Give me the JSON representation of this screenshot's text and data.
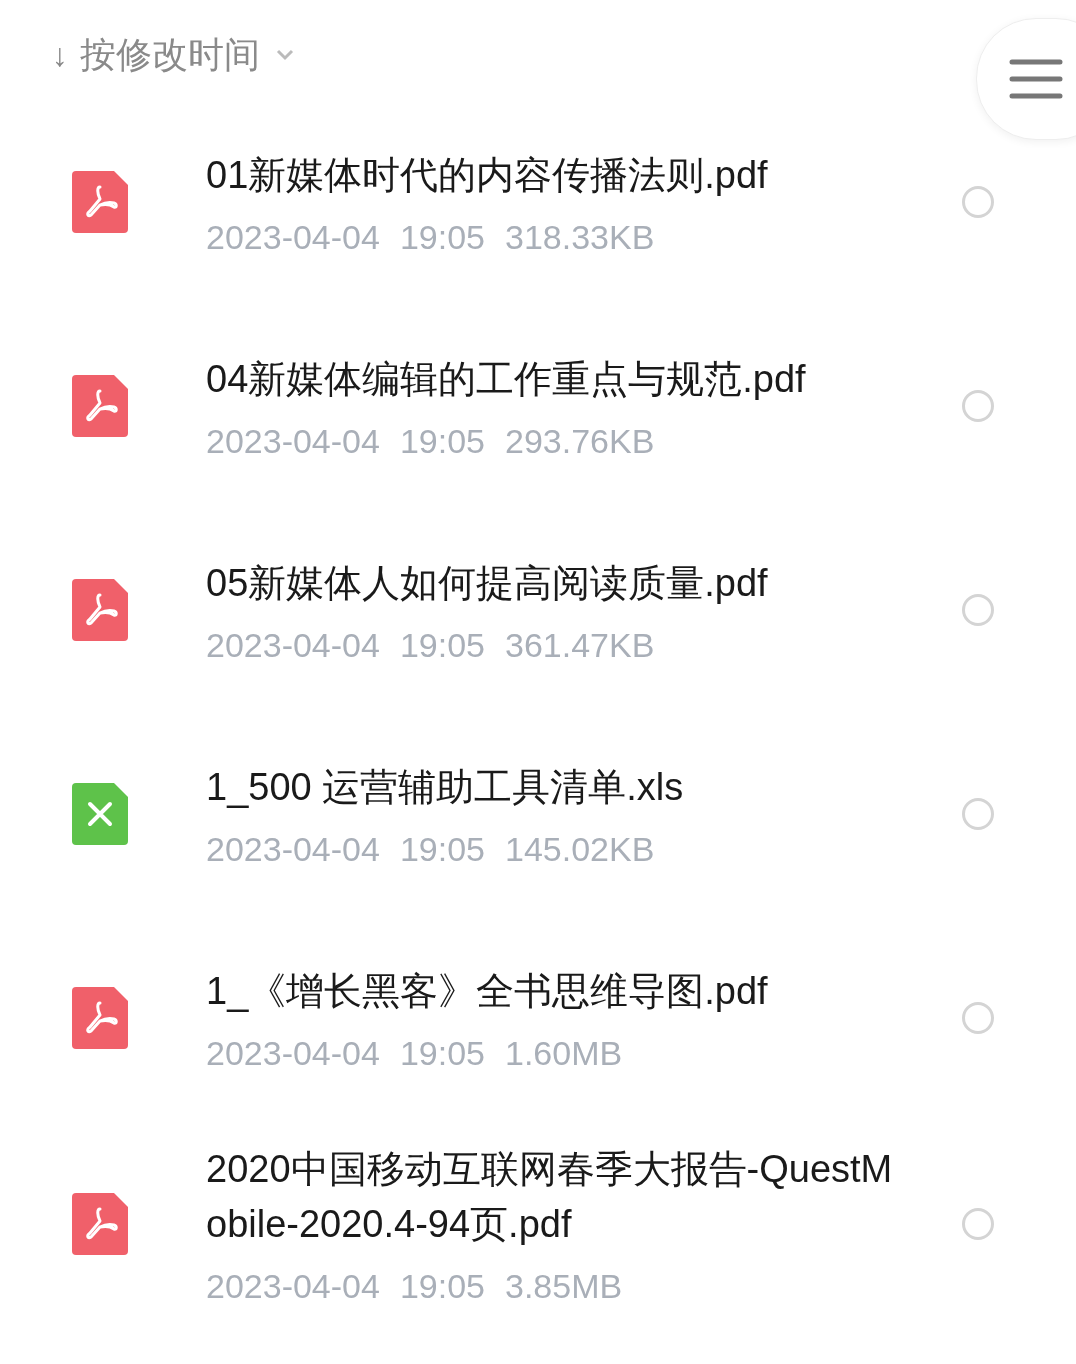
{
  "sort": {
    "arrow": "↓",
    "label": "按修改时间"
  },
  "files": [
    {
      "kind": "pdf",
      "name": "01新媒体时代的内容传播法则.pdf",
      "date": "2023-04-04",
      "time": "19:05",
      "size": "318.33KB",
      "selected": false
    },
    {
      "kind": "pdf",
      "name": "04新媒体编辑的工作重点与规范.pdf",
      "date": "2023-04-04",
      "time": "19:05",
      "size": "293.76KB",
      "selected": false
    },
    {
      "kind": "pdf",
      "name": "05新媒体人如何提高阅读质量.pdf",
      "date": "2023-04-04",
      "time": "19:05",
      "size": "361.47KB",
      "selected": false
    },
    {
      "kind": "xls",
      "name": "1_500 运营辅助工具清单.xls",
      "date": "2023-04-04",
      "time": "19:05",
      "size": "145.02KB",
      "selected": false
    },
    {
      "kind": "pdf",
      "name": "1_《增长黑客》全书思维导图.pdf",
      "date": "2023-04-04",
      "time": "19:05",
      "size": "1.60MB",
      "selected": false
    },
    {
      "kind": "pdf",
      "name": "2020中国移动互联网春季大报告-QuestMobile-2020.4-94页.pdf",
      "date": "2023-04-04",
      "time": "19:05",
      "size": "3.85MB",
      "selected": false
    }
  ]
}
